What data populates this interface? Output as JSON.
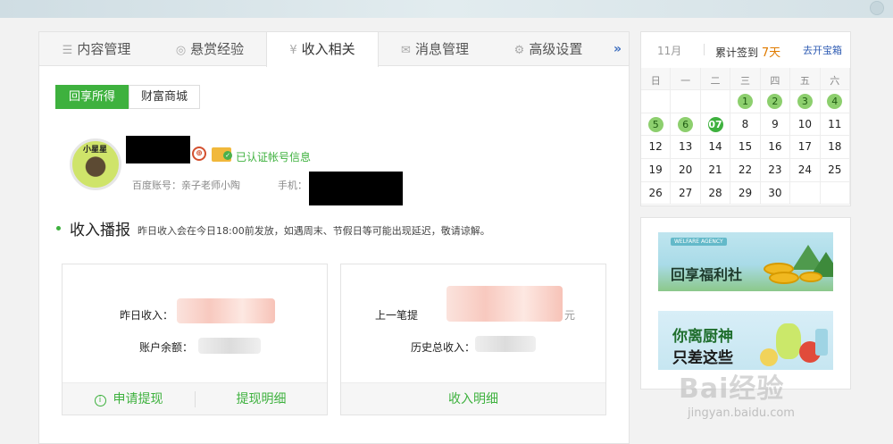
{
  "tabs": [
    {
      "label": "内容管理",
      "icon": "list-icon",
      "glyph": "☰"
    },
    {
      "label": "悬赏经验",
      "icon": "coin-icon",
      "glyph": "◎"
    },
    {
      "label": "收入相关",
      "icon": "yen-icon",
      "glyph": "¥",
      "active": true
    },
    {
      "label": "消息管理",
      "icon": "mail-icon",
      "glyph": "✉"
    },
    {
      "label": "高级设置",
      "icon": "gear-icon",
      "glyph": "⚙"
    }
  ],
  "tabs_more": "»",
  "subtabs": [
    {
      "label": "回享所得",
      "active": true
    },
    {
      "label": "财富商城",
      "active": false
    }
  ],
  "profile": {
    "avatar_text": "小星星",
    "certified_label": "已认证帐号信息",
    "account_label": "百度账号：亲子老师小陶",
    "phone_label": "手机："
  },
  "income": {
    "title": "收入播报",
    "note": "昨日收入会在今日18:00前发放，如遇周末、节假日等可能出现延迟，敬请谅解。",
    "card1": {
      "yesterday_label": "昨日收入：",
      "balance_label": "账户余额：",
      "withdraw_label": "申请提现",
      "withdraw_detail_label": "提现明细"
    },
    "card2": {
      "last_label": "上一笔提",
      "last_suffix": "元",
      "total_label": "历史总收入：",
      "detail_label": "收入明细"
    }
  },
  "calendar": {
    "month": "11月",
    "signed_prefix": "累计签到",
    "signed_days": "7天",
    "open_box": "去开宝箱",
    "weekdays": [
      "日",
      "一",
      "二",
      "三",
      "四",
      "五",
      "六"
    ],
    "weeks": [
      [
        null,
        null,
        null,
        "1",
        "2",
        "3",
        "4"
      ],
      [
        "5",
        "6",
        "07",
        "8",
        "9",
        "10",
        "11"
      ],
      [
        "12",
        "13",
        "14",
        "15",
        "16",
        "17",
        "18"
      ],
      [
        "19",
        "20",
        "21",
        "22",
        "23",
        "24",
        "25"
      ],
      [
        "26",
        "27",
        "28",
        "29",
        "30",
        null,
        null
      ]
    ],
    "signed": [
      "1",
      "2",
      "3",
      "4",
      "5",
      "6"
    ],
    "today": "07"
  },
  "ads": {
    "ad1_tag": "WELFARE AGENCY",
    "ad1_title": "回享福利社",
    "ad2_title_line1": "你离厨神",
    "ad2_title_line2": "只差这些"
  },
  "watermark": {
    "main": "Bai经验",
    "sub": "jingyan.baidu.com"
  },
  "colors": {
    "accent_green": "#3eb13e",
    "link_blue": "#2f5cb3",
    "signed_orange": "#e07b00"
  }
}
